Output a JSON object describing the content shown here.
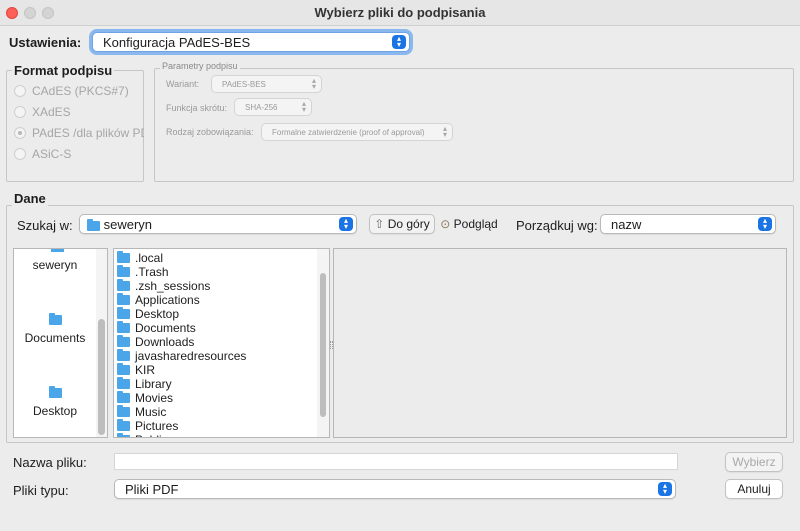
{
  "window": {
    "title": "Wybierz pliki do podpisania"
  },
  "settings": {
    "label": "Ustawienia:",
    "value": "Konfiguracja PAdES-BES"
  },
  "format": {
    "title": "Format podpisu",
    "options": [
      "CAdES (PKCS#7)",
      "XAdES",
      "PAdES /dla plików PDF",
      "ASiC-S"
    ],
    "selected": "PAdES /dla plików PDF"
  },
  "params": {
    "title": "Parametry podpisu",
    "variant_label": "Wariant:",
    "variant_value": "PAdES-BES",
    "hash_label": "Funkcja skrótu:",
    "hash_value": "SHA-256",
    "commitment_label": "Rodzaj zobowiązania:",
    "commitment_value": "Formalne zatwierdzenie (proof of approval)"
  },
  "data": {
    "title": "Dane",
    "look_in_label": "Szukaj w:",
    "look_in_value": "seweryn",
    "up_button": "Do góry",
    "preview_button": "Podgląd",
    "sort_label": "Porządkuj wg:",
    "sort_value": "nazw"
  },
  "places": [
    "seweryn",
    "Documents",
    "Desktop"
  ],
  "files": [
    ".local",
    ".Trash",
    ".zsh_sessions",
    "Applications",
    "Desktop",
    "Documents",
    "Downloads",
    "javasharedresources",
    "KIR",
    "Library",
    "Movies",
    "Music",
    "Pictures",
    "Public"
  ],
  "footer": {
    "filename_label": "Nazwa pliku:",
    "filename_value": "",
    "browse_button": "Wybierz",
    "filetype_label": "Pliki typu:",
    "filetype_value": "Pliki PDF",
    "cancel_button": "Anuluj"
  },
  "colors": {
    "accent": "#1b74e4",
    "folder": "#4aa6e8",
    "close": "#ff5f57"
  }
}
